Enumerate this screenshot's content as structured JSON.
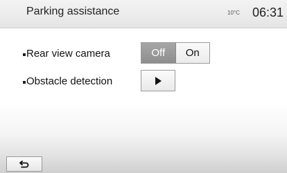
{
  "header": {
    "title": "Parking assistance",
    "temperature": "10°C",
    "time": "06:31"
  },
  "settings": [
    {
      "label": "Rear view camera",
      "control": "toggle",
      "options": [
        "Off",
        "On"
      ],
      "selected": "Off"
    },
    {
      "label": "Obstacle detection",
      "control": "submenu",
      "icon": "play-icon"
    }
  ],
  "footer": {
    "back_icon": "back-arrow-icon"
  },
  "colors": {
    "selected_segment": "#959595",
    "header_bg": "#ececec"
  }
}
